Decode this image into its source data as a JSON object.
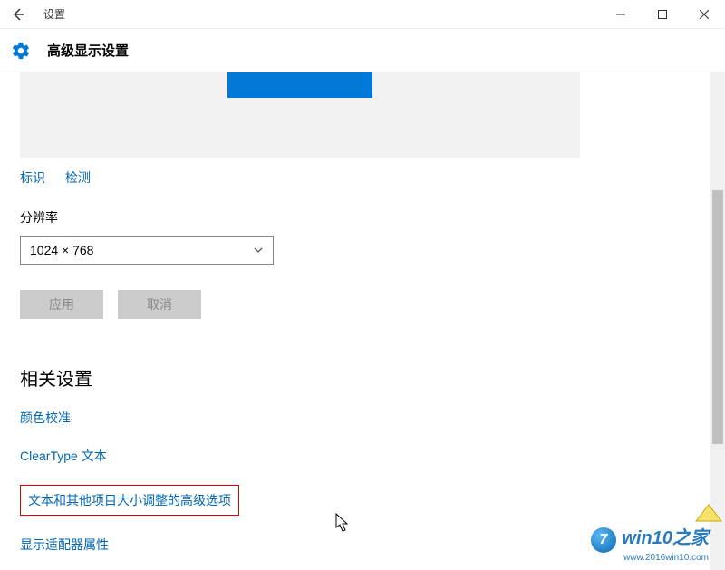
{
  "titlebar": {
    "title": "设置"
  },
  "header": {
    "title": "高级显示设置"
  },
  "links": {
    "identify": "标识",
    "detect": "检测"
  },
  "resolution": {
    "label": "分辨率",
    "value": "1024 × 768"
  },
  "buttons": {
    "apply": "应用",
    "cancel": "取消"
  },
  "related": {
    "heading": "相关设置",
    "color_calibration": "颜色校准",
    "cleartype": "ClearType 文本",
    "text_sizing": "文本和其他项目大小调整的高级选项",
    "adapter_properties": "显示适配器属性"
  },
  "watermark": {
    "brand": "win10之家",
    "url": "www.2016win10.com",
    "badge": "7"
  }
}
